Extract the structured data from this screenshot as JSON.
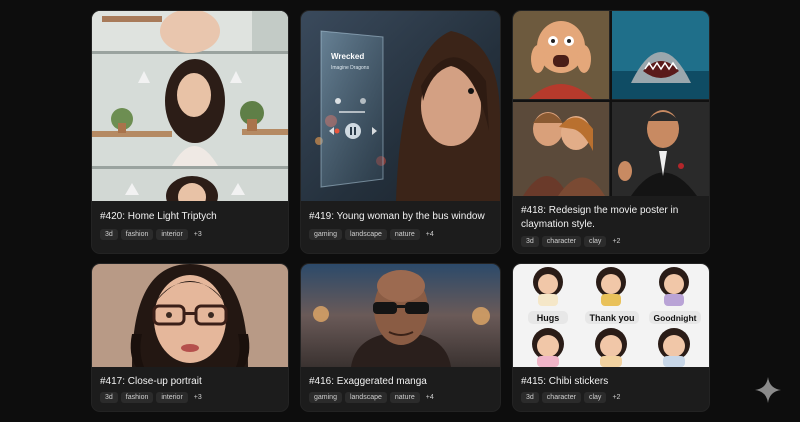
{
  "colors": {
    "background": "#0d0d0d",
    "card": "#1c1c1c",
    "tag_bg": "#2b2b2b"
  },
  "cards": [
    {
      "title": "#420: Home Light Triptych",
      "tags": [
        "3d",
        "fashion",
        "interior",
        "+3"
      ],
      "image": "woman-in-kitchen-triptych"
    },
    {
      "title": "#419: Young woman by the bus window",
      "tags": [
        "gaming",
        "landscape",
        "nature",
        "+4"
      ],
      "image": "woman-at-rainy-window-with-music-overlay",
      "overlay_text": {
        "song": "Wrecked",
        "artist": "Imagine Dragons"
      }
    },
    {
      "title": "#418: Redesign the movie poster in claymation style.",
      "tags": [
        "3d",
        "character",
        "clay",
        "+2"
      ],
      "image": "claymation-movie-posters"
    },
    {
      "title": "#417: Close-up portrait",
      "tags": [
        "3d",
        "fashion",
        "interior",
        "+3"
      ],
      "image": "woman-with-glasses-portrait"
    },
    {
      "title": "#416: Exaggerated manga",
      "tags": [
        "gaming",
        "landscape",
        "nature",
        "+4"
      ],
      "image": "bald-man-with-sunglasses"
    },
    {
      "title": "#415: Chibi stickers",
      "tags": [
        "3d",
        "character",
        "clay",
        "+2"
      ],
      "image": "chibi-girl-stickers",
      "sticker_labels": [
        "Hugs",
        "Thank you",
        "Goodnight"
      ]
    }
  ],
  "corner_icon": "sparkle-icon"
}
